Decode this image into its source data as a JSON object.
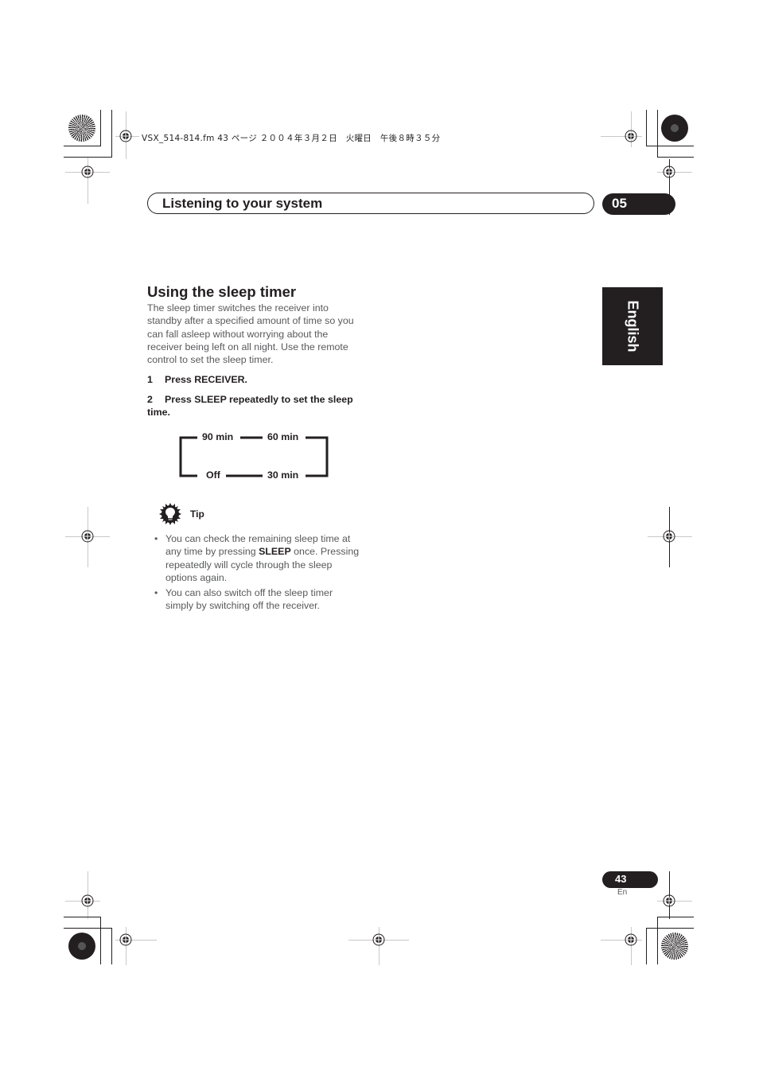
{
  "print_header": {
    "file_info": "VSX_514-814.fm  43 ページ  ２００４年３月２日　火曜日　午後８時３５分"
  },
  "section": {
    "title": "Listening to your system",
    "chapter": "05"
  },
  "language_tab": "English",
  "content": {
    "heading": "Using the sleep timer",
    "intro": "The sleep timer switches the receiver into standby after a specified amount of time so you can fall asleep without worrying about the receiver being left on all night. Use the remote control to set the sleep timer.",
    "steps": [
      {
        "num": "1",
        "text": "Press RECEIVER."
      },
      {
        "num": "2",
        "text": "Press SLEEP repeatedly to set the sleep time."
      }
    ],
    "cycle_diagram": {
      "top_left": "90 min",
      "top_right": "60 min",
      "bottom_left": "Off",
      "bottom_right": "30 min"
    },
    "tip": {
      "icon": "lightbulb-gear-icon",
      "label": "Tip",
      "items": [
        {
          "before": "You can check the remaining sleep time at any time by pressing ",
          "bold": "SLEEP",
          "after": " once. Pressing repeatedly will cycle through the sleep options again."
        },
        {
          "before": "You can also switch off the sleep timer simply by switching off the receiver.",
          "bold": "",
          "after": ""
        }
      ]
    }
  },
  "footer": {
    "page_number": "43",
    "page_lang": "En"
  },
  "colors": {
    "ink": "#231f20",
    "body_text": "#58595b",
    "registration_gray": "#c8c8c8"
  }
}
